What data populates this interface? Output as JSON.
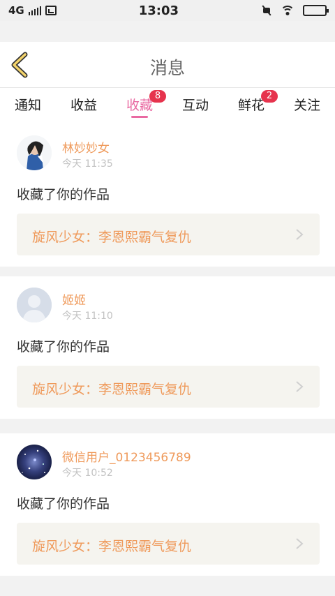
{
  "status_bar": {
    "network": "4G",
    "time": "13:03"
  },
  "header": {
    "title": "消息"
  },
  "tabs": [
    {
      "label": "通知",
      "badge": ""
    },
    {
      "label": "收益",
      "badge": ""
    },
    {
      "label": "收藏",
      "badge": "8",
      "active": true
    },
    {
      "label": "互动",
      "badge": ""
    },
    {
      "label": "鲜花",
      "badge": "2"
    },
    {
      "label": "关注",
      "badge": ""
    }
  ],
  "messages": [
    {
      "author": "林妙妙女",
      "time": "今天 11:35",
      "action": "收藏了你的作品",
      "work_title": "旋风少女：李恩熙霸气复仇",
      "avatar": "photo"
    },
    {
      "author": "姬姬",
      "time": "今天 11:10",
      "action": "收藏了你的作品",
      "work_title": "旋风少女：李恩熙霸气复仇",
      "avatar": "default"
    },
    {
      "author": "微信用户_0123456789",
      "time": "今天 10:52",
      "action": "收藏了你的作品",
      "work_title": "旋风少女：李恩熙霸气复仇",
      "avatar": "galaxy"
    }
  ],
  "colors": {
    "accent": "#e96aa2",
    "badge": "#e6334d",
    "author": "#ef9a5b",
    "back_icon": "#f3d36b"
  }
}
